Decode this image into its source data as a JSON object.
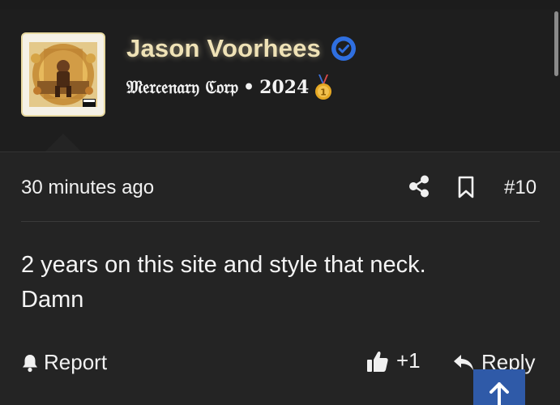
{
  "user": {
    "name": "Jason Voorhees",
    "title": "𝔐𝔢𝔯𝔠𝔢𝔫𝔞𝔯𝔶 ℭ𝔬𝔯𝔭",
    "separator": "•",
    "year": "2024",
    "name_color": "#efe2b6",
    "verified_color": "#2f6fe0"
  },
  "avatar": {
    "icon": "album-cover-icon",
    "advisory_text": "PARENTAL ADVISORY"
  },
  "post": {
    "timestamp": "30 minutes ago",
    "number": "#10",
    "body_line1": "2 years on this site and style that neck.",
    "body_line2": "Damn"
  },
  "actions": {
    "report_label": "Report",
    "like_count": "+1",
    "reply_label": "Reply"
  },
  "colors": {
    "background": "#242424",
    "header_background": "#1e1e1e",
    "scroll_top_button": "#2f5aa8"
  }
}
